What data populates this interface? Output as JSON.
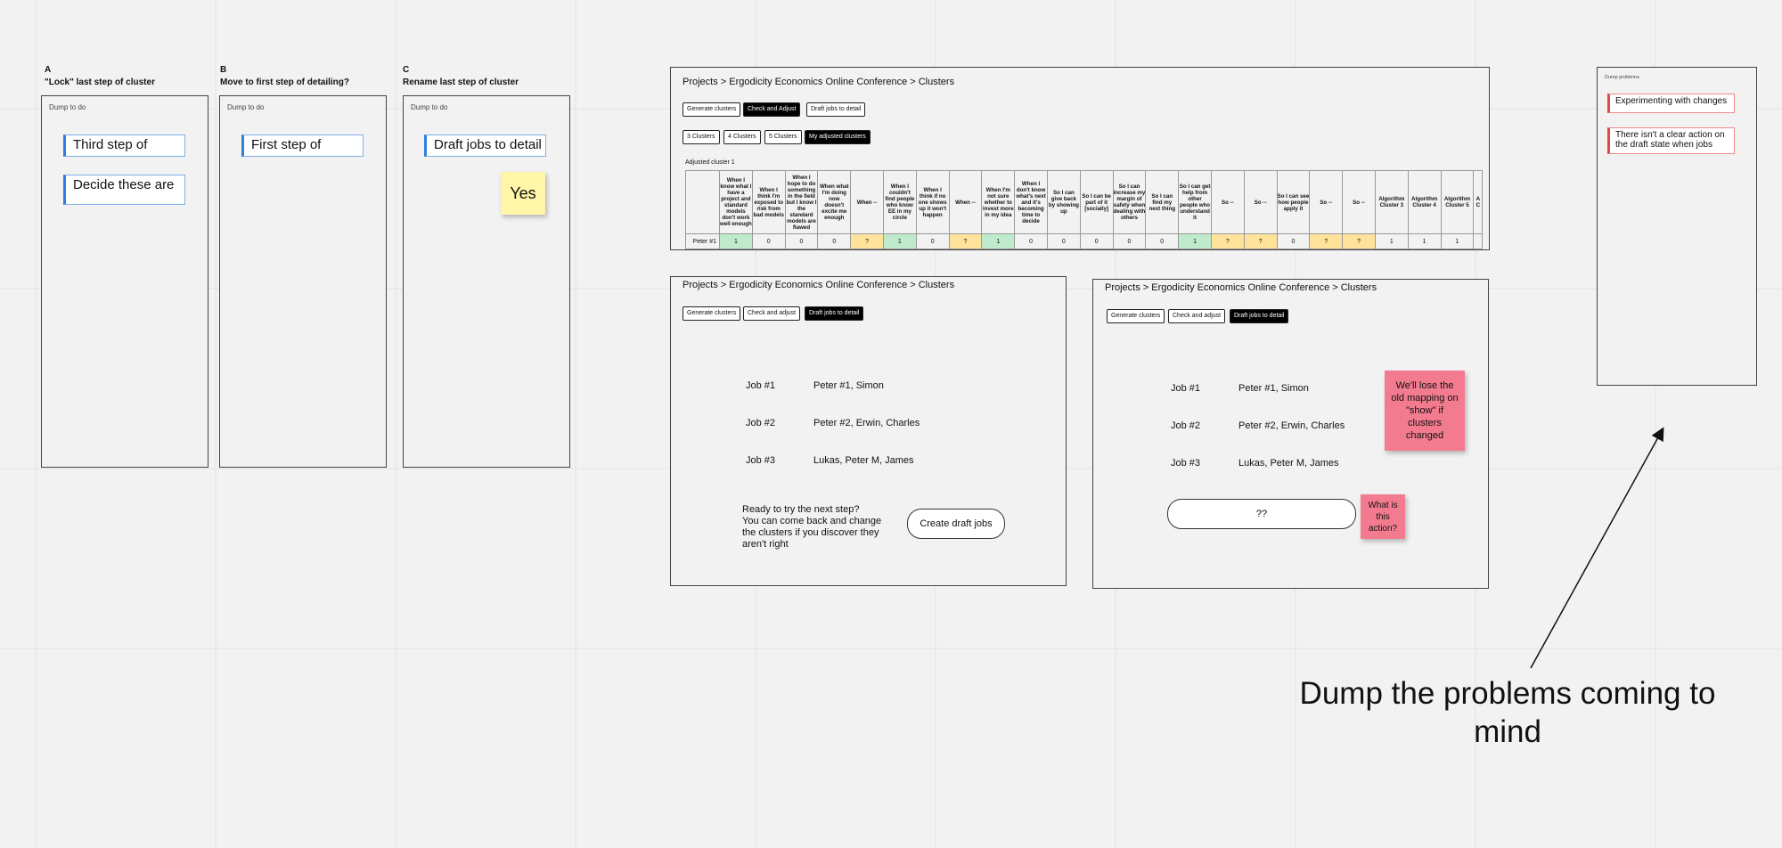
{
  "columns": [
    {
      "letter": "A",
      "title": "\"Lock\" last step of cluster",
      "dump_label": "Dump to do",
      "cards": [
        "Third step of",
        "Decide these are"
      ]
    },
    {
      "letter": "B",
      "title": "Move to first step of detailing?",
      "dump_label": "Dump to do",
      "cards": [
        "First step of"
      ]
    },
    {
      "letter": "C",
      "title": "Rename last step of cluster",
      "dump_label": "Dump to do",
      "cards": [
        "Draft jobs to detail"
      ],
      "sticky": "Yes"
    }
  ],
  "frame_top": {
    "breadcrumb": "Projects > Ergodicity Economics Online Conference > Clusters",
    "tabs": [
      "Generate clusters",
      "Check and Adjust",
      "Draft jobs to detail"
    ],
    "cluster_buttons": [
      "3 Clusters",
      "4 Clusters",
      "5 Clusters",
      "My adjusted clusters"
    ],
    "section_label": "Adjusted cluster 1",
    "row_label": "Peter #1",
    "headers": [
      "When I know what I have a project and standard models don't work well enough",
      "When I think I'm exposed to risk from bad models",
      "When I hope to do something in the field but I know I the standard models are flawed",
      "When what I'm doing now doesn't excite me enough",
      "When --",
      "When I couldn't find people who know EE in my circle",
      "When I think if no one shows up it won't happen",
      "When --",
      "When I'm not sure whether to invest more in my idea",
      "When I don't know what's next and it's becoming time to decide",
      "So I can give back by showing up",
      "So I can be part of it [socially]",
      "So I can increase my margin of safety when dealing with others",
      "So I can find my next thing",
      "So I can get help from other people who understand it",
      "So --",
      "So --",
      "So I can see how people apply it",
      "So --",
      "So --",
      "Algorithm Cluster 3",
      "Algorithm Cluster 4",
      "Algorithm Cluster 5",
      "A C"
    ],
    "values": [
      "1",
      "0",
      "0",
      "0",
      "?",
      "1",
      "0",
      "?",
      "1",
      "0",
      "0",
      "0",
      "0",
      "0",
      "1",
      "?",
      "?",
      "0",
      "?",
      "?",
      "1",
      "1",
      "1",
      ""
    ],
    "colors": [
      "green",
      "",
      "",
      "",
      "yellow",
      "green",
      "",
      "yellow",
      "green",
      "",
      "",
      "",
      "",
      "",
      "green",
      "yellow",
      "yellow",
      "",
      "yellow",
      "yellow",
      "",
      "",
      "",
      ""
    ]
  },
  "frame_left": {
    "breadcrumb": "Projects > Ergodicity Economics Online Conference > Clusters",
    "tabs": [
      "Generate clusters",
      "Check and adjust",
      "Draft jobs to detail"
    ],
    "jobs": [
      {
        "job": "Job #1",
        "people": "Peter #1, Simon"
      },
      {
        "job": "Job #2",
        "people": "Peter #2, Erwin, Charles"
      },
      {
        "job": "Job #3",
        "people": "Lukas, Peter M, James"
      }
    ],
    "prompt_lines": [
      "Ready to try the next step?",
      "You can come back and change",
      "the clusters if you discover they",
      "aren't right"
    ],
    "cta": "Create draft jobs"
  },
  "frame_right": {
    "breadcrumb": "Projects > Ergodicity Economics Online Conference > Clusters",
    "tabs": [
      "Generate clusters",
      "Check and adjust",
      "Draft jobs to detail"
    ],
    "jobs": [
      {
        "job": "Job #1",
        "people": "Peter #1, Simon"
      },
      {
        "job": "Job #2",
        "people": "Peter #2, Erwin, Charles"
      },
      {
        "job": "Job #3",
        "people": "Lukas, Peter M, James"
      }
    ],
    "cta": "??",
    "sticky_mapping": "We'll lose the old mapping on \"show\" if clusters changed",
    "sticky_action": "What is this action?"
  },
  "problems": {
    "label": "Dump problems",
    "items": [
      "Experimenting with changes",
      "There isn't a clear action on the draft state when jobs"
    ]
  },
  "annotation": {
    "line1": "Dump the problems coming to",
    "line2": "mind"
  },
  "colors": {
    "sticky_yellow": "#fff6a8",
    "sticky_pink": "#f27b8f",
    "tab_active": "#000000",
    "card_accent": "#2f7fdc",
    "problem_accent": "#e64545"
  }
}
